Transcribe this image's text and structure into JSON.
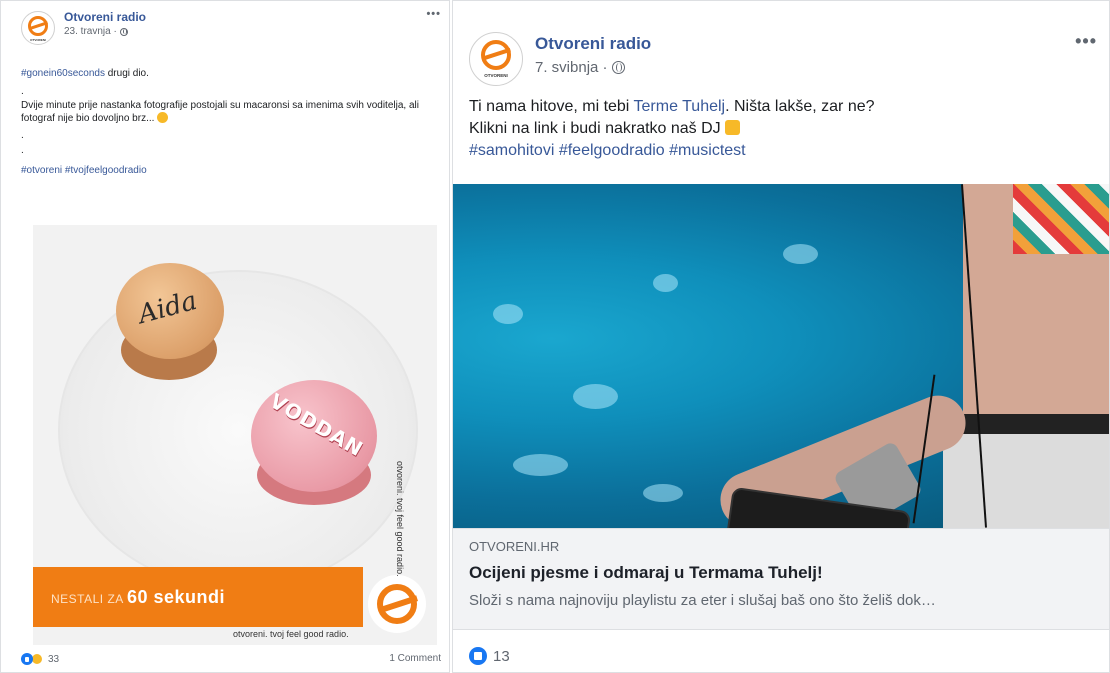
{
  "left_post": {
    "page_name": "Otvoreni radio",
    "avatar_text": "OTVORENI",
    "date": "23. travnja",
    "hashtag_line_tag": "#gonein60seconds",
    "hashtag_line_rest": " drugi dio.",
    "dot1": ".",
    "body_text": "Dvije minute prije nastanka fotografije postojali su macaronsi sa imenima svih voditelja, ali fotograf nije bio dovoljno brz...",
    "dot2": ".",
    "dot3": ".",
    "hashtags": "#otvoreni #tvojfeelgoodradio",
    "image": {
      "macaron1_text": "Aida",
      "macaron2_text": "VODDAN",
      "band_prefix": "NESTALI ZA ",
      "band_bold": "60 sekundi",
      "side_slogan": "otvoreni. tvoj feel good radio.",
      "bottom_slogan": "otvoreni. tvoj feel good radio."
    },
    "reaction_count": "33",
    "comments": "1 Comment",
    "icons": [
      "like-icon",
      "haha-icon",
      "globe-icon",
      "more-icon"
    ]
  },
  "right_post": {
    "page_name": "Otvoreni radio",
    "avatar_text": "OTVORENI",
    "date": "7. svibnja",
    "line1_prefix": "Ti nama hitove, mi tebi ",
    "line1_link": "Terme Tuhelj",
    "line1_suffix": ". Ništa lakše, zar ne?",
    "line2": "Klikni na link i budi nakratko naš DJ",
    "hashtags": "#samohitovi #feelgoodradio #musictest",
    "link": {
      "domain": "OTVORENI.HR",
      "title": "Ocijeni pjesme i odmaraj u Termama Tuhelj!",
      "description": "Složi s nama najnoviju playlistu za eter i slušaj baš ono što želiš dok…"
    },
    "reaction_count": "13",
    "icons": [
      "like-icon",
      "globe-icon",
      "more-icon",
      "pointing-down-emoji"
    ]
  },
  "colors": {
    "brand_orange": "#f07d14",
    "facebook_link": "#385898",
    "like_blue": "#1877f2"
  }
}
